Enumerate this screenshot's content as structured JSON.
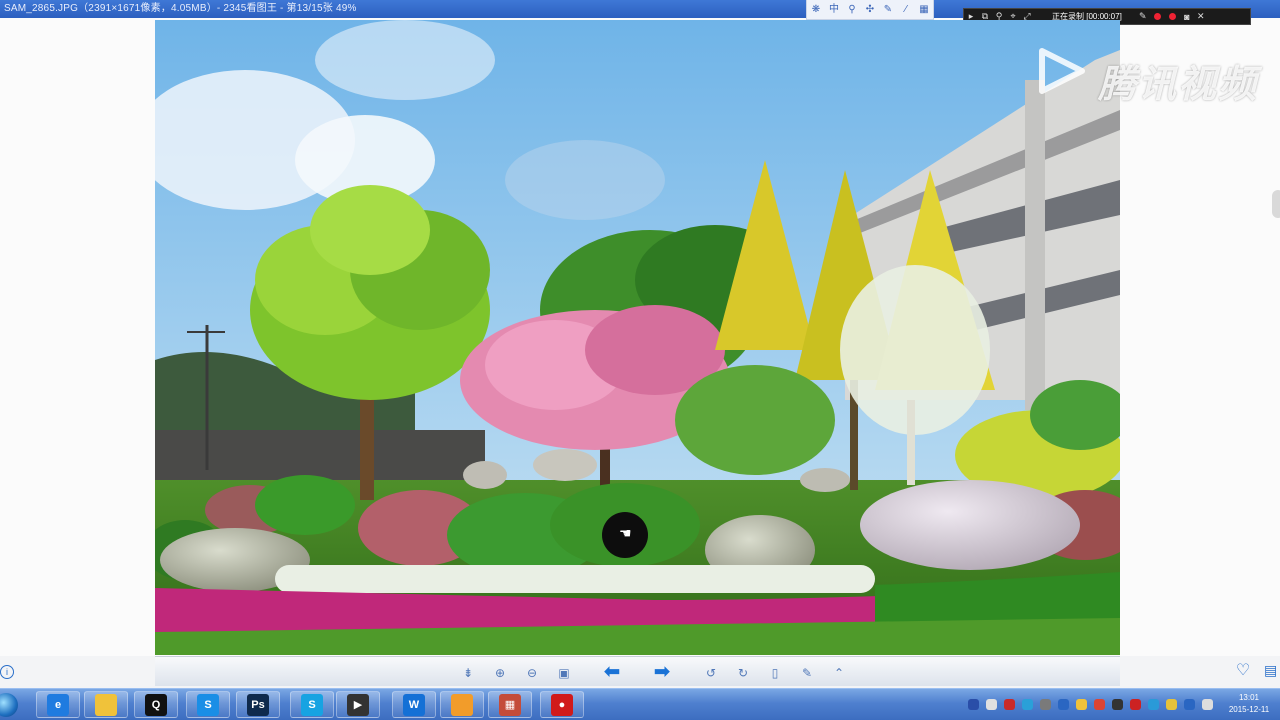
{
  "window": {
    "title": "SAM_2865.JPG（2391×1671像素，4.05MB）- 2345看图王 - 第13/15张 49%"
  },
  "viewer_toolbar_icons": [
    "paw-icon",
    "rotate-icon",
    "pin-icon",
    "arrows-icon",
    "pen-icon",
    "wand-icon",
    "grid-icon"
  ],
  "recorder": {
    "status": "正在录制 [00:00:07]",
    "icons": [
      "play-icon",
      "copy-icon",
      "zoom-icon",
      "cursor-icon",
      "expand-icon",
      "pen-icon",
      "record-dot",
      "record-dot",
      "camera-icon",
      "close-icon"
    ]
  },
  "watermark": {
    "text": "腾讯视频"
  },
  "bottom_toolbar": {
    "buttons": [
      "fit-icon",
      "zoom-in-icon",
      "zoom-out-icon",
      "info-icon",
      "prev-arrow",
      "next-arrow",
      "rotate-left-icon",
      "rotate-right-icon",
      "delete-icon",
      "edit-icon",
      "more-icon"
    ]
  },
  "taskbar": {
    "apps": [
      {
        "name": "ie",
        "label": "e",
        "color": "#1f7be0"
      },
      {
        "name": "explorer",
        "label": "",
        "color": "#f0c23a"
      },
      {
        "name": "qq",
        "label": "Q",
        "color": "#111111"
      },
      {
        "name": "sogou",
        "label": "S",
        "color": "#1a8ee6"
      },
      {
        "name": "photoshop",
        "label": "Ps",
        "color": "#0f2a4d"
      },
      {
        "name": "browser",
        "label": "S",
        "color": "#17a3e2"
      },
      {
        "name": "media",
        "label": "▶",
        "color": "#333333"
      },
      {
        "name": "wps",
        "label": "W",
        "color": "#1470d6"
      },
      {
        "name": "paint",
        "label": "",
        "color": "#f29c2a"
      },
      {
        "name": "viewer",
        "label": "▦",
        "color": "#c44c3a"
      },
      {
        "name": "recorder",
        "label": "●",
        "color": "#d11a1a"
      }
    ],
    "clock": {
      "time": "13:01",
      "date": "2015-12-11"
    }
  }
}
